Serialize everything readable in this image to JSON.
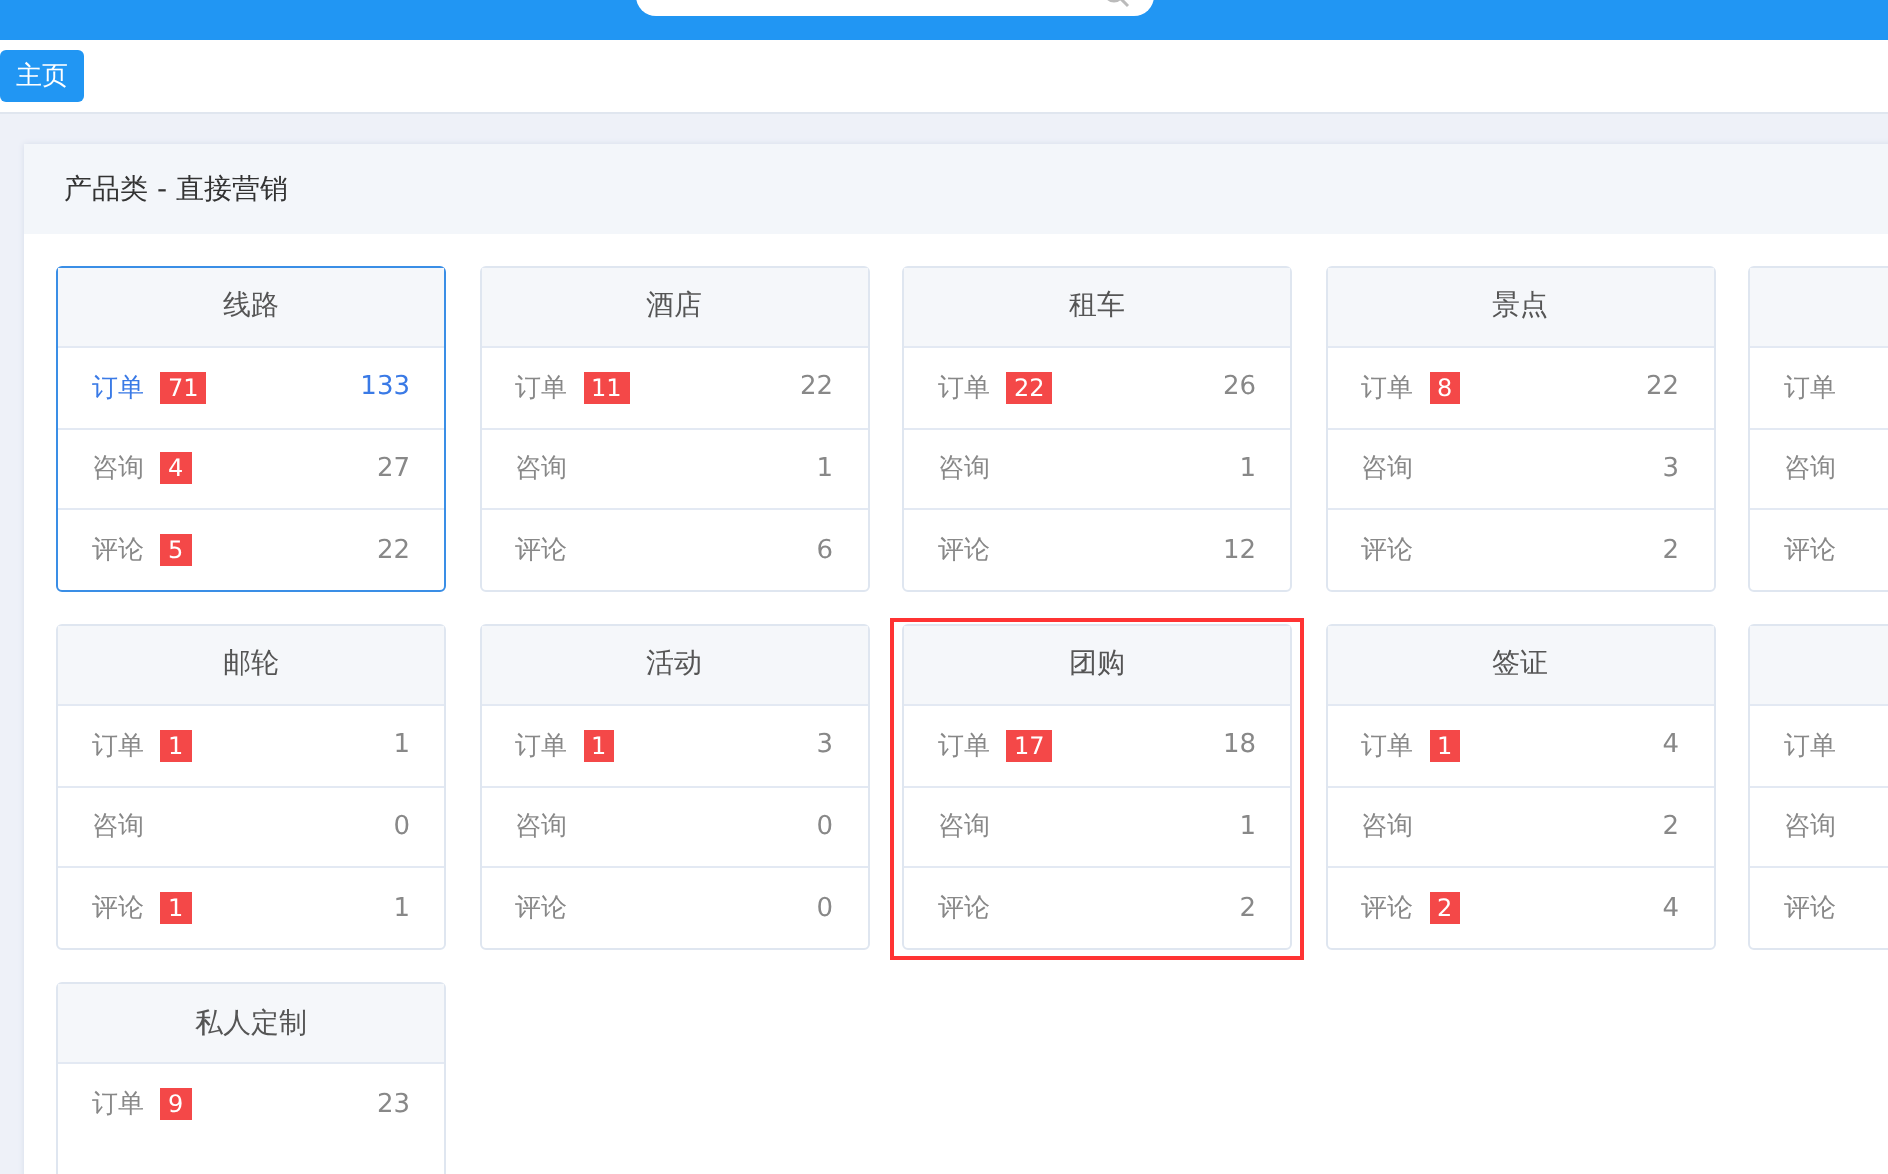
{
  "tabs": [
    {
      "label": "主页",
      "selected": true
    }
  ],
  "panel": {
    "title": "产品类 - 直接营销",
    "cards": [
      {
        "title": "线路",
        "selected": true,
        "highlighted": false,
        "rows": [
          {
            "label": "订单",
            "badge": "71",
            "count": "133"
          },
          {
            "label": "咨询",
            "badge": "4",
            "count": "27"
          },
          {
            "label": "评论",
            "badge": "5",
            "count": "22"
          }
        ]
      },
      {
        "title": "酒店",
        "selected": false,
        "highlighted": false,
        "rows": [
          {
            "label": "订单",
            "badge": "11",
            "count": "22"
          },
          {
            "label": "咨询",
            "count": "1"
          },
          {
            "label": "评论",
            "count": "6"
          }
        ]
      },
      {
        "title": "租车",
        "selected": false,
        "highlighted": false,
        "rows": [
          {
            "label": "订单",
            "badge": "22",
            "count": "26"
          },
          {
            "label": "咨询",
            "count": "1"
          },
          {
            "label": "评论",
            "count": "12"
          }
        ]
      },
      {
        "title": "景点",
        "selected": false,
        "highlighted": false,
        "rows": [
          {
            "label": "订单",
            "badge": "8",
            "count": "22"
          },
          {
            "label": "咨询",
            "count": "3"
          },
          {
            "label": "评论",
            "count": "2"
          }
        ]
      },
      {
        "selected": false,
        "highlighted": false,
        "rows": [
          {
            "label": "订单"
          },
          {
            "label": "咨询"
          },
          {
            "label": "评论"
          }
        ]
      },
      {
        "title": "邮轮",
        "selected": false,
        "highlighted": false,
        "rows": [
          {
            "label": "订单",
            "badge": "1",
            "count": "1"
          },
          {
            "label": "咨询",
            "count": "0"
          },
          {
            "label": "评论",
            "badge": "1",
            "count": "1"
          }
        ]
      },
      {
        "title": "活动",
        "selected": false,
        "highlighted": false,
        "rows": [
          {
            "label": "订单",
            "badge": "1",
            "count": "3"
          },
          {
            "label": "咨询",
            "count": "0"
          },
          {
            "label": "评论",
            "count": "0"
          }
        ]
      },
      {
        "title": "团购",
        "selected": false,
        "highlighted": true,
        "rows": [
          {
            "label": "订单",
            "badge": "17",
            "count": "18"
          },
          {
            "label": "咨询",
            "count": "1"
          },
          {
            "label": "评论",
            "count": "2"
          }
        ]
      },
      {
        "title": "签证",
        "selected": false,
        "highlighted": false,
        "rows": [
          {
            "label": "订单",
            "badge": "1",
            "count": "4"
          },
          {
            "label": "咨询",
            "count": "2"
          },
          {
            "label": "评论",
            "badge": "2",
            "count": "4"
          }
        ]
      },
      {
        "selected": false,
        "highlighted": false,
        "rows": [
          {
            "label": "订单"
          },
          {
            "label": "咨询"
          },
          {
            "label": "评论"
          }
        ]
      },
      {
        "title": "私人定制",
        "selected": false,
        "highlighted": false,
        "rows": [
          {
            "label": "订单",
            "badge": "9",
            "count": "23"
          }
        ]
      }
    ]
  }
}
